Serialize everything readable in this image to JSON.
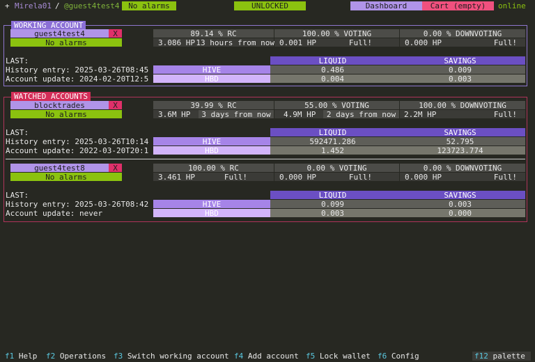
{
  "header": {
    "prefix": "+",
    "app": "Mirela01",
    "sep": "/",
    "account": "@guest4test4",
    "alarms": "No alarms",
    "wallet_state": "UNLOCKED",
    "dashboard": "Dashboard",
    "cart": "Cart (empty)",
    "status": "online"
  },
  "labels": {
    "last": "LAST:",
    "liquid": "LIQUID",
    "savings": "SAVINGS",
    "hive": "HIVE",
    "hbd": "HBD"
  },
  "working": {
    "title": "WORKING ACCOUNT",
    "account": {
      "name": "guest4test4",
      "close": "X",
      "alarms": "No alarms",
      "rc": "89.14 % RC",
      "voting": "100.00 % VOTING",
      "downvoting": "0.00 % DOWNVOTING",
      "hp1": "3.086 HP",
      "time1": "13 hours from now",
      "hp2": "0.001 HP",
      "time2": "Full!",
      "hp3": "0.000 HP",
      "time3": "Full!",
      "history": "History entry: 2025-03-26T08:45",
      "update": "Account update: 2024-02-20T12:5",
      "hive_liquid": "0.486",
      "hive_savings": "0.009",
      "hbd_liquid": "0.004",
      "hbd_savings": "0.003"
    }
  },
  "watched": {
    "title": "WATCHED ACCOUNTS",
    "accounts": [
      {
        "name": "blocktrades",
        "close": "X",
        "alarms": "No alarms",
        "rc": "39.99 % RC",
        "voting": "55.00 % VOTING",
        "downvoting": "100.00 % DOWNVOTING",
        "hp1": "3.6M HP",
        "time1": "3 days from now",
        "hp2": "4.9M HP",
        "time2": "2 days from now",
        "hp3": "2.2M HP",
        "time3": "Full!",
        "history": "History entry: 2025-03-26T10:14",
        "update": "Account update: 2022-03-20T20:1",
        "hive_liquid": "592471.286",
        "hive_savings": "52.795",
        "hbd_liquid": "1.452",
        "hbd_savings": "123723.774"
      },
      {
        "name": "guest4test8",
        "close": "X",
        "alarms": "No alarms",
        "rc": "100.00 % RC",
        "voting": "0.00 % VOTING",
        "downvoting": "0.00 % DOWNVOTING",
        "hp1": "3.461 HP",
        "time1": "Full!",
        "hp2": "0.000 HP",
        "time2": "Full!",
        "hp3": "0.000 HP",
        "time3": "Full!",
        "history": "History entry: 2025-03-26T08:42",
        "update": "Account update: never",
        "hive_liquid": "0.099",
        "hive_savings": "0.003",
        "hbd_liquid": "0.003",
        "hbd_savings": "0.000"
      }
    ]
  },
  "footer": {
    "items": [
      {
        "key": "f1",
        "label": "Help"
      },
      {
        "key": "f2",
        "label": "Operations"
      },
      {
        "key": "f3",
        "label": "Switch working account"
      },
      {
        "key": "f4",
        "label": "Add account"
      },
      {
        "key": "f5",
        "label": "Lock wallet"
      },
      {
        "key": "f6",
        "label": "Config"
      }
    ],
    "palette_key": "f12",
    "palette_label": "palette"
  }
}
